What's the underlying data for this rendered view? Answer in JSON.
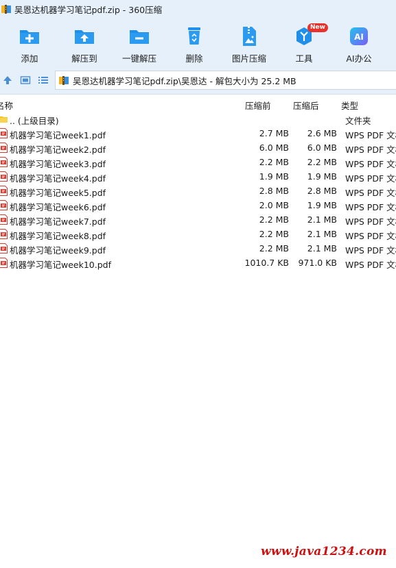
{
  "window": {
    "title": "吴恩达机器学习笔记pdf.zip - 360压缩"
  },
  "toolbar": {
    "items": [
      {
        "label": "添加",
        "icon": "add-folder-icon"
      },
      {
        "label": "解压到",
        "icon": "extract-to-icon"
      },
      {
        "label": "一键解压",
        "icon": "one-click-extract-icon"
      },
      {
        "label": "删除",
        "icon": "recycle-bin-icon"
      },
      {
        "label": "图片压缩",
        "icon": "image-compress-icon"
      },
      {
        "label": "工具",
        "icon": "tools-cube-icon",
        "badge": "New"
      },
      {
        "label": "AI办公",
        "icon": "ai-office-icon"
      }
    ]
  },
  "nav": {
    "path": "吴恩达机器学习笔记pdf.zip\\吴恩达 - 解包大小为 25.2 MB"
  },
  "columns": {
    "name": "名称",
    "compressed": "压缩前",
    "original": "压缩后",
    "type": "类型"
  },
  "files": [
    {
      "name": ".. (上级目录)",
      "compressed": "",
      "original": "",
      "type": "文件夹",
      "kind": "folder"
    },
    {
      "name": "机器学习笔记week1.pdf",
      "compressed": "2.7 MB",
      "original": "2.6 MB",
      "type": "WPS PDF 文档",
      "kind": "pdf"
    },
    {
      "name": "机器学习笔记week2.pdf",
      "compressed": "6.0 MB",
      "original": "6.0 MB",
      "type": "WPS PDF 文档",
      "kind": "pdf"
    },
    {
      "name": "机器学习笔记week3.pdf",
      "compressed": "2.2 MB",
      "original": "2.2 MB",
      "type": "WPS PDF 文档",
      "kind": "pdf"
    },
    {
      "name": "机器学习笔记week4.pdf",
      "compressed": "1.9 MB",
      "original": "1.9 MB",
      "type": "WPS PDF 文档",
      "kind": "pdf"
    },
    {
      "name": "机器学习笔记week5.pdf",
      "compressed": "2.8 MB",
      "original": "2.8 MB",
      "type": "WPS PDF 文档",
      "kind": "pdf"
    },
    {
      "name": "机器学习笔记week6.pdf",
      "compressed": "2.0 MB",
      "original": "1.9 MB",
      "type": "WPS PDF 文档",
      "kind": "pdf"
    },
    {
      "name": "机器学习笔记week7.pdf",
      "compressed": "2.2 MB",
      "original": "2.1 MB",
      "type": "WPS PDF 文档",
      "kind": "pdf"
    },
    {
      "name": "机器学习笔记week8.pdf",
      "compressed": "2.2 MB",
      "original": "2.1 MB",
      "type": "WPS PDF 文档",
      "kind": "pdf"
    },
    {
      "name": "机器学习笔记week9.pdf",
      "compressed": "2.2 MB",
      "original": "2.1 MB",
      "type": "WPS PDF 文档",
      "kind": "pdf"
    },
    {
      "name": "机器学习笔记week10.pdf",
      "compressed": "1010.7 KB",
      "original": "971.0 KB",
      "type": "WPS PDF 文档",
      "kind": "pdf"
    }
  ],
  "watermark": "www.java1234.com",
  "colors": {
    "toolbar_bg": "#e6f0fb",
    "icon_blue": "#1f8fea",
    "badge_red": "#e8332c",
    "watermark_red": "#cc1111"
  }
}
